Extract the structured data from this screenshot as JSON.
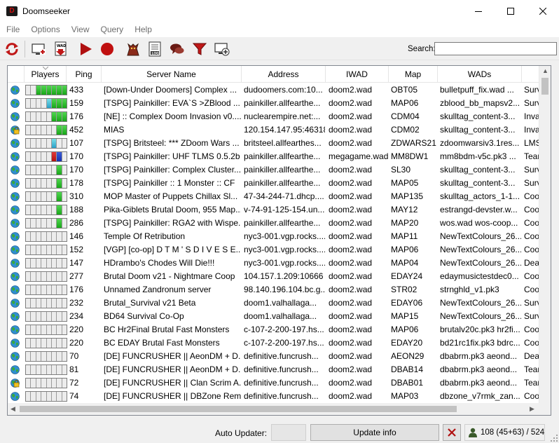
{
  "window": {
    "title": "Doomseeker"
  },
  "menu": [
    "File",
    "Options",
    "View",
    "Query",
    "Help"
  ],
  "toolbar": {
    "icons": [
      "refresh-icon",
      "add-server-icon",
      "wad-download-icon",
      "play-icon",
      "record-icon",
      "demon-icon",
      "log-icon",
      "chat-icon",
      "filter-icon",
      "create-server-icon"
    ]
  },
  "search": {
    "label": "Search:",
    "value": ""
  },
  "columns": [
    "Players",
    "Ping",
    "Server Name",
    "Address",
    "IWAD",
    "Map",
    "WADs",
    ""
  ],
  "servers": [
    {
      "slots": "..gggggg",
      "lock": false,
      "ping": "433",
      "name": "[Down-Under Doomers] Complex ...",
      "address": "dudoomers.com:10...",
      "iwad": "doom2.wad",
      "map": "OBT05",
      "wads": "bulletpuff_fix.wad ...",
      "mode": "Surv"
    },
    {
      "slots": "....sggg",
      "lock": false,
      "ping": "159",
      "name": "[TSPG] Painkiller: EVA`S >ZBlood ...",
      "address": "painkiller.allfearthe...",
      "iwad": "doom2.wad",
      "map": "MAP06",
      "wads": "zblood_bb_mapsv2...",
      "mode": "Surv"
    },
    {
      "slots": ".....ggg",
      "lock": false,
      "ping": "176",
      "name": "[NE] :: Complex Doom Invasion v0....",
      "address": "nuclearempire.net:...",
      "iwad": "doom2.wad",
      "map": "CDM04",
      "wads": "skulltag_content-3...",
      "mode": "Inva"
    },
    {
      "slots": "......gg",
      "lock": true,
      "ping": "452",
      "name": "MIAS",
      "address": "120.154.147.95:46318",
      "iwad": "doom2.wad",
      "map": "CDM02",
      "wads": "skulltag_content-3...",
      "mode": "Inva"
    },
    {
      "slots": ".....s..",
      "lock": false,
      "ping": "107",
      "name": "[TSPG] Britsteel: *** ZDoom Wars ...",
      "address": "britsteel.allfearthes...",
      "iwad": "doom2.wad",
      "map": "ZDWARS21",
      "wads": "zdoomwarsiv3.1res...",
      "mode": "LMS"
    },
    {
      "slots": ".....rb.",
      "lock": false,
      "ping": "170",
      "name": "[TSPG] Painkiller: UHF TLMS 0.5.2b",
      "address": "painkiller.allfearthe...",
      "iwad": "megagame.wad",
      "map": "MM8DW1",
      "wads": "mm8bdm-v5c.pk3 ...",
      "mode": "Tear"
    },
    {
      "slots": "......g.",
      "lock": false,
      "ping": "170",
      "name": "[TSPG] Painkiller: Complex Cluster...",
      "address": "painkiller.allfearthe...",
      "iwad": "doom2.wad",
      "map": "SL30",
      "wads": "skulltag_content-3...",
      "mode": "Surv"
    },
    {
      "slots": "......g.",
      "lock": false,
      "ping": "178",
      "name": "[TSPG] Painkiller :: 1 Monster :: CF",
      "address": "painkiller.allfearthe...",
      "iwad": "doom2.wad",
      "map": "MAP05",
      "wads": "skulltag_content-3...",
      "mode": "Surv"
    },
    {
      "slots": "......g.",
      "lock": false,
      "ping": "310",
      "name": "MOP Master of Puppets  Chillax Sl...",
      "address": "47-34-244-71.dhcp....",
      "iwad": "doom2.wad",
      "map": "MAP135",
      "wads": "skulltag_actors_1-1...",
      "mode": "Coo"
    },
    {
      "slots": "......g.",
      "lock": false,
      "ping": "188",
      "name": "Pika-Giblets Brutal Doom, 955 Map...",
      "address": "v-74-91-125-154.un...",
      "iwad": "doom2.wad",
      "map": "MAY12",
      "wads": "estrangd-devster.w...",
      "mode": "Coo"
    },
    {
      "slots": "......g.",
      "lock": false,
      "ping": "286",
      "name": "[TSPG] Painkiller: RGA2 with Wispe...",
      "address": "painkiller.allfearthe...",
      "iwad": "doom2.wad",
      "map": "MAP20",
      "wads": "wos.wad wos-coop...",
      "mode": "Coo"
    },
    {
      "slots": "........",
      "lock": false,
      "ping": "146",
      "name": "Temple Of Retribution",
      "address": "nyc3-001.vgp.rocks....",
      "iwad": "doom2.wad",
      "map": "MAP11",
      "wads": "NewTextColours_26...",
      "mode": "Coo"
    },
    {
      "slots": "........",
      "lock": false,
      "ping": "152",
      "name": "[VGP] [co-op] D T M ' S  D I V E  S E...",
      "address": "nyc3-001.vgp.rocks....",
      "iwad": "doom2.wad",
      "map": "MAP06",
      "wads": "NewTextColours_26...",
      "mode": "Coo"
    },
    {
      "slots": "........",
      "lock": false,
      "ping": "147",
      "name": "HDrambo's Chodes Will Die!!!",
      "address": "nyc3-001.vgp.rocks....",
      "iwad": "doom2.wad",
      "map": "MAP04",
      "wads": "NewTextColours_26...",
      "mode": "Deat"
    },
    {
      "slots": "........",
      "lock": false,
      "ping": "277",
      "name": " Brutal Doom v21 - Nightmare Coop",
      "address": "104.157.1.209:10666",
      "iwad": "doom2.wad",
      "map": "EDAY24",
      "wads": "edaymusictestdec0...",
      "mode": "Coo"
    },
    {
      "slots": "........",
      "lock": false,
      "ping": "176",
      "name": "Unnamed Zandronum server",
      "address": "98.140.196.104.bc.g...",
      "iwad": "doom2.wad",
      "map": "STR02",
      "wads": "strnghld_v1.pk3",
      "mode": "Coo"
    },
    {
      "slots": "........",
      "lock": false,
      "ping": "232",
      "name": "Brutal_Survival v21 Beta",
      "address": "doom1.valhallaga...",
      "iwad": "doom2.wad",
      "map": "EDAY06",
      "wads": "NewTextColours_26...",
      "mode": "Surv"
    },
    {
      "slots": "........",
      "lock": false,
      "ping": "234",
      "name": "BD64 Survival Co-Op",
      "address": "doom1.valhallaga...",
      "iwad": "doom2.wad",
      "map": "MAP15",
      "wads": "NewTextColours_26...",
      "mode": "Surv"
    },
    {
      "slots": "........",
      "lock": false,
      "ping": "220",
      "name": "BC Hr2Final Brutal Fast Monsters",
      "address": "c-107-2-200-197.hs...",
      "iwad": "doom2.wad",
      "map": "MAP06",
      "wads": "brutalv20c.pk3 hr2fi...",
      "mode": "Coo"
    },
    {
      "slots": "........",
      "lock": false,
      "ping": "220",
      "name": "BC EDAY Brutal Fast Monsters",
      "address": "c-107-2-200-197.hs...",
      "iwad": "doom2.wad",
      "map": "EDAY20",
      "wads": "bd21rc1fix.pk3 bdrc...",
      "mode": "Coo"
    },
    {
      "slots": "........",
      "lock": false,
      "ping": "70",
      "name": "[DE] FUNCRUSHER || AeonDM + D...",
      "address": "definitive.funcrush...",
      "iwad": "doom2.wad",
      "map": "AEON29",
      "wads": "dbabrm.pk3 aeond...",
      "mode": "Deat"
    },
    {
      "slots": "........",
      "lock": false,
      "ping": "81",
      "name": "[DE] FUNCRUSHER || AeonDM + D...",
      "address": "definitive.funcrush...",
      "iwad": "doom2.wad",
      "map": "DBAB14",
      "wads": "dbabrm.pk3 aeond...",
      "mode": "Tear"
    },
    {
      "slots": "........",
      "lock": true,
      "ping": "72",
      "name": "[DE] FUNCRUSHER || Clan Scrim A...",
      "address": "definitive.funcrush...",
      "iwad": "doom2.wad",
      "map": "DBAB01",
      "wads": "dbabrm.pk3 aeond...",
      "mode": "Tear"
    },
    {
      "slots": "........",
      "lock": false,
      "ping": "74",
      "name": "[DE] FUNCRUSHER || DBZone Rem...",
      "address": "definitive.funcrush...",
      "iwad": "doom2.wad",
      "map": "MAP03",
      "wads": "dbzone_v7rmk_zan...",
      "mode": "Coo"
    }
  ],
  "status": {
    "auto_updater_label": "Auto Updater:",
    "update_info_label": "Update info",
    "player_count": "108 (45+63) / 524"
  }
}
